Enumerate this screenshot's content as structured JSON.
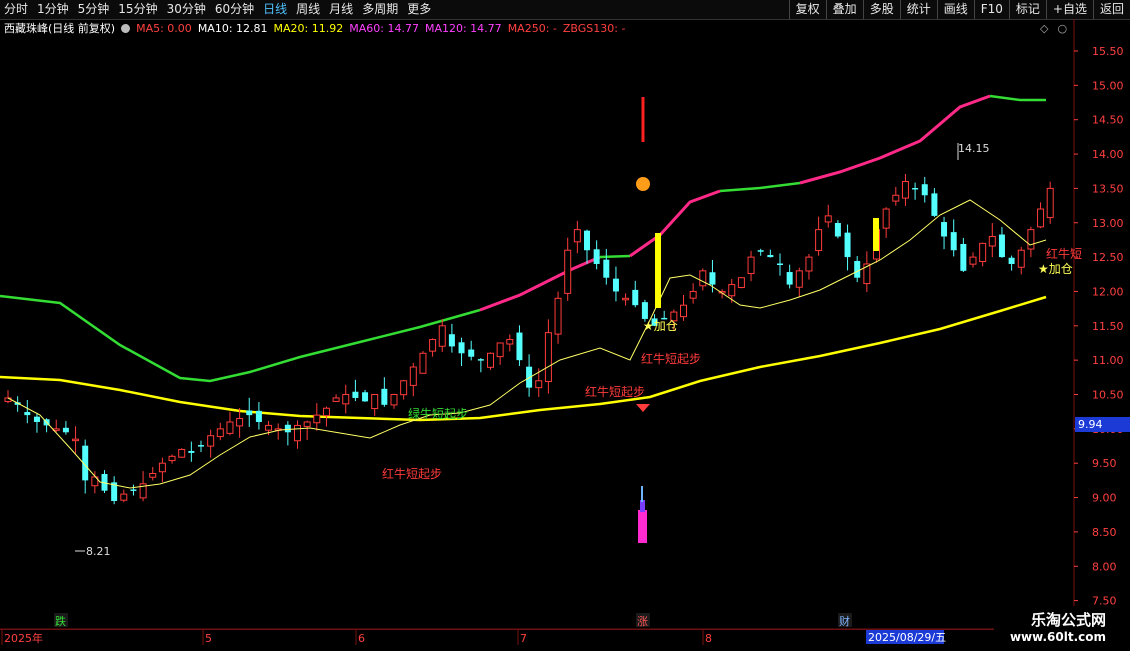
{
  "toolbar": {
    "periods": [
      "分时",
      "1分钟",
      "5分钟",
      "15分钟",
      "30分钟",
      "60分钟",
      "日线",
      "周线",
      "月线",
      "多周期",
      "更多"
    ],
    "active_period": "日线",
    "actions": [
      "复权",
      "叠加",
      "多股",
      "统计",
      "画线",
      "F10",
      "标记",
      "+自选",
      "返回"
    ]
  },
  "stock": {
    "name": "西藏珠峰(日线 前复权)"
  },
  "ma_indicators": [
    {
      "label": "MA5: 0.00",
      "color": "#ff4040"
    },
    {
      "label": "MA10: 12.81",
      "color": "#ffffff"
    },
    {
      "label": "MA20: 11.92",
      "color": "#ffff00"
    },
    {
      "label": "MA60: 14.77",
      "color": "#ff40ff"
    },
    {
      "label": "MA120: 14.77",
      "color": "#ff40ff"
    },
    {
      "label": "MA250: -",
      "color": "#ff4040"
    },
    {
      "label": "ZBGS130: -",
      "color": "#ff4040"
    }
  ],
  "price_axis": [
    "15.50",
    "15.00",
    "14.50",
    "14.00",
    "13.50",
    "13.00",
    "12.50",
    "12.00",
    "11.50",
    "11.00",
    "10.50",
    "10.00",
    "9.50",
    "9.00",
    "8.50",
    "8.00",
    "7.50"
  ],
  "current_price_tag": "9.94",
  "annotations": {
    "high": "14.15",
    "low": "8.21",
    "signal_red_bull": "红牛短起步",
    "signal_add": "★加仓",
    "signal_red_bull_short": "红牛短",
    "signal_green": "绿牛短起步"
  },
  "date_axis": {
    "labels": [
      "2025年",
      "5",
      "6",
      "7",
      "8"
    ],
    "current_date": "2025/08/29/五"
  },
  "event_markers": [
    "跌",
    "涨",
    "财"
  ],
  "watermark": {
    "line1": "乐淘公式网",
    "line2": "www.60lt.com"
  },
  "colors": {
    "up": "#ff3b3b",
    "down": "#54ffff",
    "ma_yellow": "#ffff00",
    "band_green": "#33dd33",
    "band_pink": "#ff2a88"
  }
}
